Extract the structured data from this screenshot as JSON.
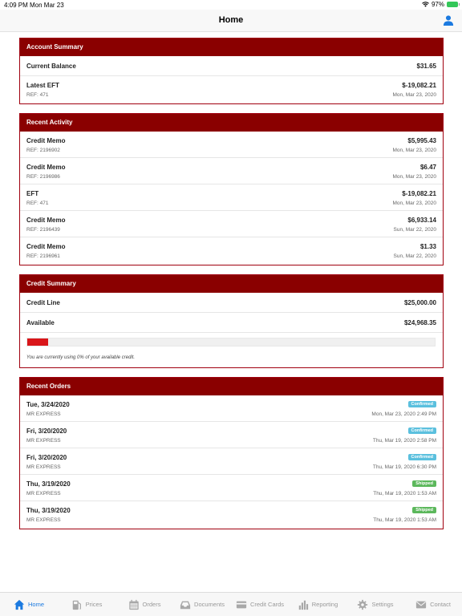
{
  "status_bar": {
    "time": "4:09 PM",
    "date": "Mon Mar 23",
    "battery": "97%"
  },
  "nav": {
    "title": "Home"
  },
  "account_summary": {
    "header": "Account Summary",
    "current_balance_label": "Current Balance",
    "current_balance_value": "$31.65",
    "latest_eft_label": "Latest EFT",
    "latest_eft_value": "$-19,082.21",
    "latest_eft_ref": "REF: 471",
    "latest_eft_date": "Mon, Mar 23, 2020"
  },
  "recent_activity": {
    "header": "Recent Activity",
    "items": [
      {
        "title": "Credit Memo",
        "amount": "$5,995.43",
        "ref": "REF: 2196902",
        "date": "Mon, Mar 23, 2020"
      },
      {
        "title": "Credit Memo",
        "amount": "$6.47",
        "ref": "REF: 2196986",
        "date": "Mon, Mar 23, 2020"
      },
      {
        "title": "EFT",
        "amount": "$-19,082.21",
        "ref": "REF: 471",
        "date": "Mon, Mar 23, 2020"
      },
      {
        "title": "Credit Memo",
        "amount": "$6,933.14",
        "ref": "REF: 2196439",
        "date": "Sun, Mar 22, 2020"
      },
      {
        "title": "Credit Memo",
        "amount": "$1.33",
        "ref": "REF: 2196961",
        "date": "Sun, Mar 22, 2020"
      }
    ]
  },
  "credit_summary": {
    "header": "Credit Summary",
    "credit_line_label": "Credit Line",
    "credit_line_value": "$25,000.00",
    "available_label": "Available",
    "available_value": "$24,968.35",
    "usage_percent": 0,
    "note": "You are currently using 0% of your available credit."
  },
  "recent_orders": {
    "header": "Recent Orders",
    "items": [
      {
        "date": "Tue, 3/24/2020",
        "vendor": "MR EXPRESS",
        "status": "Confirmed",
        "status_type": "confirmed",
        "timestamp": "Mon, Mar 23, 2020 2:49 PM"
      },
      {
        "date": "Fri, 3/20/2020",
        "vendor": "MR EXPRESS",
        "status": "Confirmed",
        "status_type": "confirmed",
        "timestamp": "Thu, Mar 19, 2020 2:58 PM"
      },
      {
        "date": "Fri, 3/20/2020",
        "vendor": "MR EXPRESS",
        "status": "Confirmed",
        "status_type": "confirmed",
        "timestamp": "Thu, Mar 19, 2020 6:30 PM"
      },
      {
        "date": "Thu, 3/19/2020",
        "vendor": "MR EXPRESS",
        "status": "Shipped",
        "status_type": "shipped",
        "timestamp": "Thu, Mar 19, 2020 1:53 AM"
      },
      {
        "date": "Thu, 3/19/2020",
        "vendor": "MR EXPRESS",
        "status": "Shipped",
        "status_type": "shipped",
        "timestamp": "Thu, Mar 19, 2020 1:53 AM"
      }
    ]
  },
  "tabbar": {
    "items": [
      {
        "label": "Home",
        "icon": "home-icon",
        "active": true
      },
      {
        "label": "Prices",
        "icon": "fuel-pump-icon",
        "active": false
      },
      {
        "label": "Orders",
        "icon": "calendar-icon",
        "active": false
      },
      {
        "label": "Documents",
        "icon": "inbox-icon",
        "active": false
      },
      {
        "label": "Credit Cards",
        "icon": "credit-card-icon",
        "active": false
      },
      {
        "label": "Reporting",
        "icon": "bar-chart-icon",
        "active": false
      },
      {
        "label": "Settings",
        "icon": "gear-icon",
        "active": false
      },
      {
        "label": "Contact",
        "icon": "envelope-icon",
        "active": false
      }
    ]
  },
  "colors": {
    "header_bg": "#8a0000",
    "accent": "#1b7ae0",
    "confirmed": "#5bc0de",
    "shipped": "#5cb85c",
    "progress": "#d9161a"
  }
}
